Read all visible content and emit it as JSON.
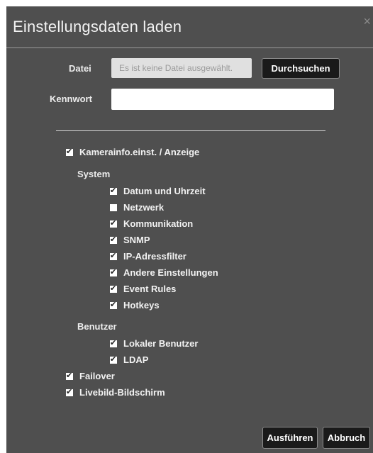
{
  "dialog": {
    "title": "Einstellungsdaten laden",
    "close_glyph": "×"
  },
  "file": {
    "label": "Datei",
    "value": "Es ist keine Datei ausgewählt.",
    "browse_label": "Durchsuchen"
  },
  "password": {
    "label": "Kennwort",
    "value": ""
  },
  "options": {
    "camera": {
      "label": "Kamerainfo.einst. / Anzeige",
      "checked": true
    },
    "system_heading": "System",
    "system_items": [
      {
        "label": "Datum und Uhrzeit",
        "checked": true
      },
      {
        "label": "Netzwerk",
        "checked": false
      },
      {
        "label": "Kommunikation",
        "checked": true
      },
      {
        "label": "SNMP",
        "checked": true
      },
      {
        "label": "IP-Adressfilter",
        "checked": true
      },
      {
        "label": "Andere Einstellungen",
        "checked": true
      },
      {
        "label": "Event Rules",
        "checked": true
      },
      {
        "label": "Hotkeys",
        "checked": true
      }
    ],
    "user_heading": "Benutzer",
    "user_items": [
      {
        "label": "Lokaler Benutzer",
        "checked": true
      },
      {
        "label": "LDAP",
        "checked": true
      }
    ],
    "failover": {
      "label": "Failover",
      "checked": true
    },
    "liveview": {
      "label": "Livebild-Bildschirm",
      "checked": true
    }
  },
  "footer": {
    "run_label": "Ausführen",
    "cancel_label": "Abbruch"
  }
}
